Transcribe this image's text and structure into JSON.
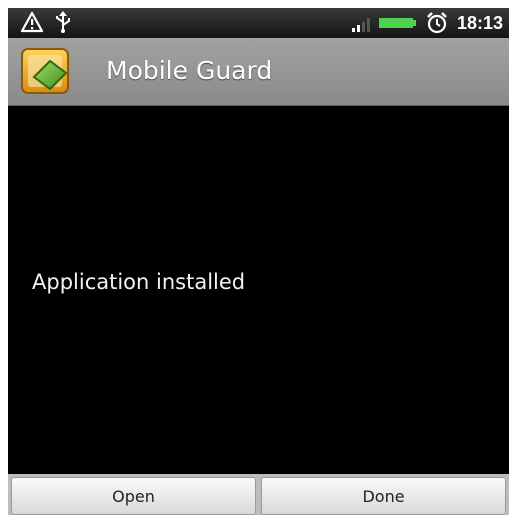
{
  "status_bar": {
    "time": "18:13",
    "icons": [
      "warning-icon",
      "usb-icon",
      "signal-icon",
      "battery-icon",
      "alarm-icon"
    ]
  },
  "title_bar": {
    "app_name": "Mobile Guard",
    "icon": "mobile-guard-app-icon"
  },
  "main": {
    "message": "Application installed"
  },
  "buttons": {
    "open_label": "Open",
    "done_label": "Done"
  },
  "colors": {
    "status_bar_bg": "#1e1e1e",
    "title_bar_bg": "#999999",
    "content_bg": "#000000",
    "battery_green": "#4cd24c",
    "button_bg": "#eeeeee"
  }
}
